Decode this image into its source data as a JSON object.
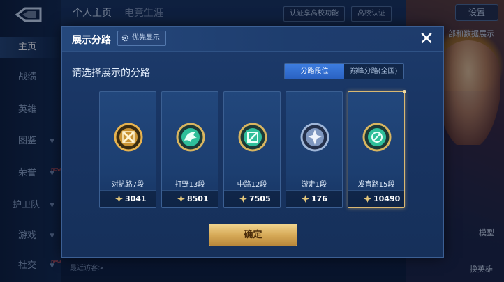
{
  "sidebar": {
    "items": [
      {
        "label": "主页",
        "active": true
      },
      {
        "label": "战绩"
      },
      {
        "label": "英雄"
      },
      {
        "label": "图鉴",
        "caret": true
      },
      {
        "label": "荣誉",
        "caret": true,
        "badge": "new"
      },
      {
        "label": "护卫队",
        "caret": true
      },
      {
        "label": "游戏",
        "caret": true
      },
      {
        "label": "社交",
        "caret": true,
        "badge": "new"
      }
    ]
  },
  "topbar": {
    "tabs": [
      "个人主页",
      "电竞生涯"
    ],
    "verify_button": "认证享高校功能",
    "campus_button": "高校认证",
    "settings": "设置",
    "right_snippet": "部和数据展示"
  },
  "right_panel": {
    "model_label": "模型",
    "switch_hero_label": "换英雄"
  },
  "bottom": {
    "recent_visitors": "最近访客>"
  },
  "dialog": {
    "title": "展示分路",
    "priority_button": "优先显示",
    "close": "✕",
    "prompt": "请选择展示的分路",
    "toggle": {
      "left": "分路段位",
      "right": "巅峰分路(全国)"
    },
    "confirm": "确定",
    "lanes": [
      {
        "name": "对抗路7段",
        "score": "3041",
        "badge_icon": "clash-lane-icon",
        "selected": false,
        "color": "#e7b24e"
      },
      {
        "name": "打野13段",
        "score": "8501",
        "badge_icon": "jungle-lane-icon",
        "selected": false,
        "color": "#35c7a2"
      },
      {
        "name": "中路12段",
        "score": "7505",
        "badge_icon": "mid-lane-icon",
        "selected": false,
        "color": "#35c7a2"
      },
      {
        "name": "游走1段",
        "score": "176",
        "badge_icon": "roam-lane-icon",
        "selected": false,
        "color": "#9fb6d8"
      },
      {
        "name": "发育路15段",
        "score": "10490",
        "badge_icon": "farm-lane-icon",
        "selected": true,
        "color": "#35c7a2"
      }
    ]
  }
}
